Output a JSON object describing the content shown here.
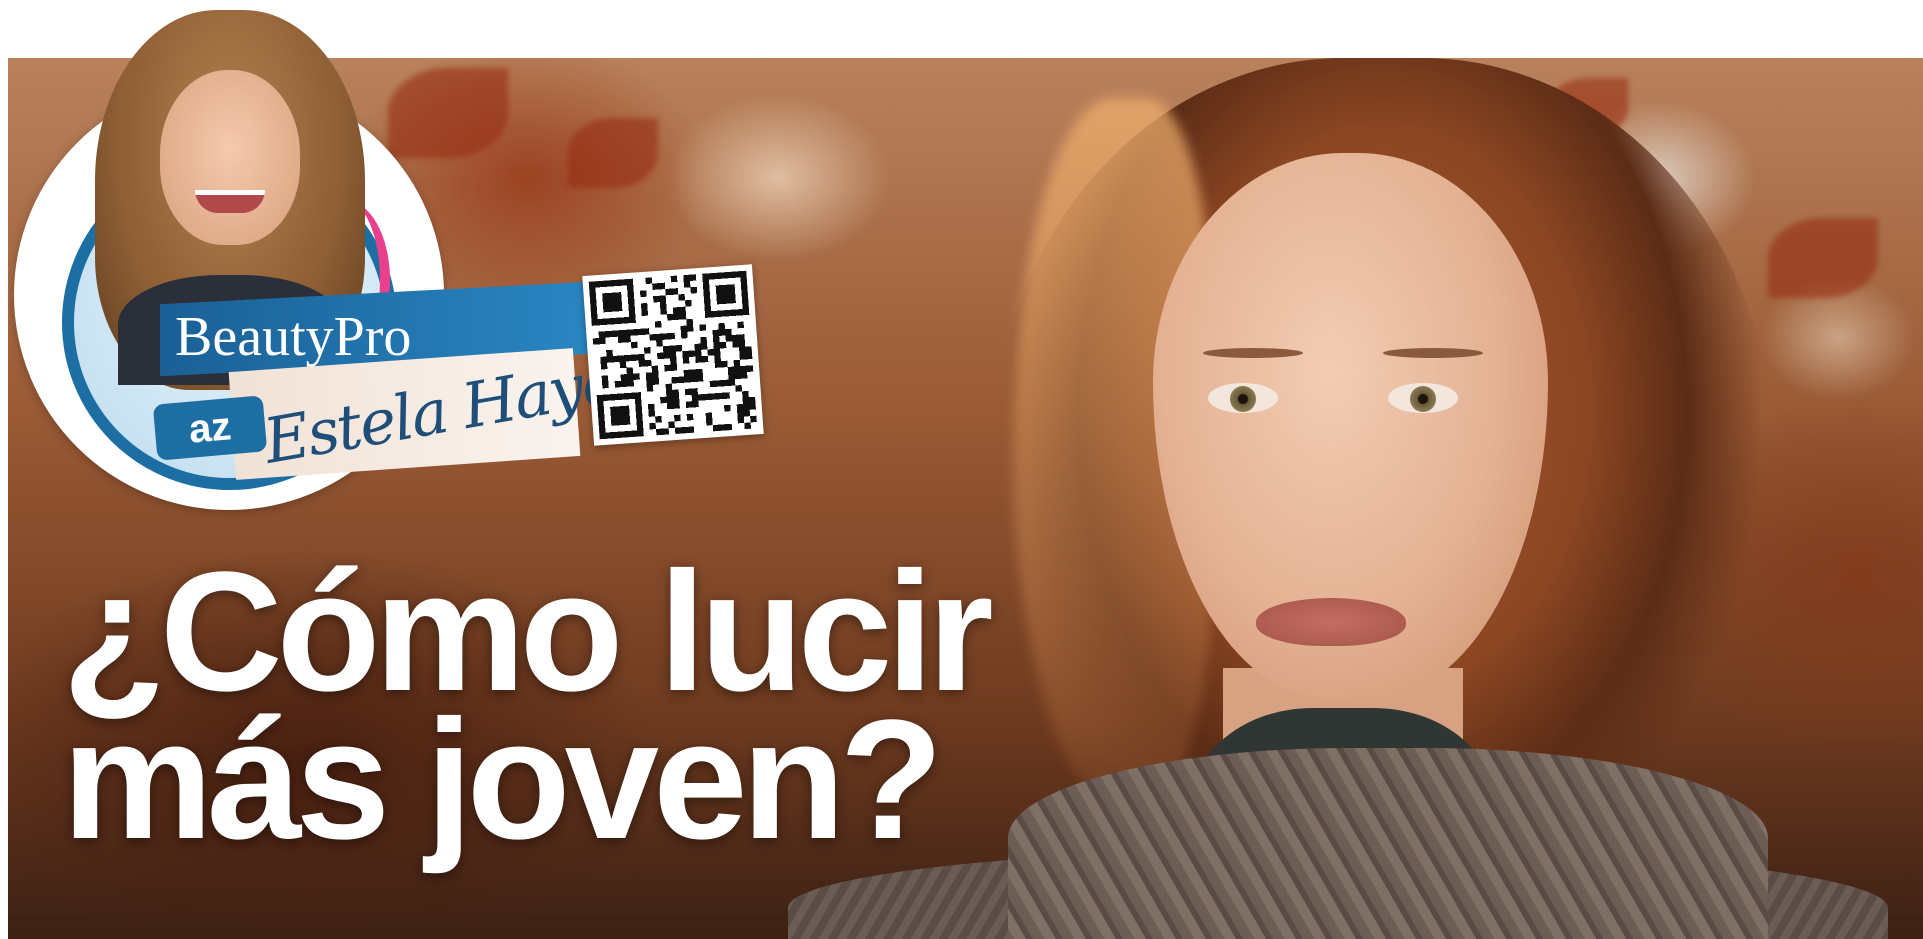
{
  "headline": {
    "line1": "¿Cómo lucir",
    "line2": "más joven?"
  },
  "logo": {
    "brand": "BeautyPro",
    "badge": "az",
    "signature": "Estela Hayes"
  },
  "colors": {
    "brand_blue": "#1d6fa3",
    "accent_pink": "#ea3f8c",
    "headline_text": "#ffffff"
  },
  "icons": [
    "qr-code-icon",
    "az-logo-icon"
  ]
}
